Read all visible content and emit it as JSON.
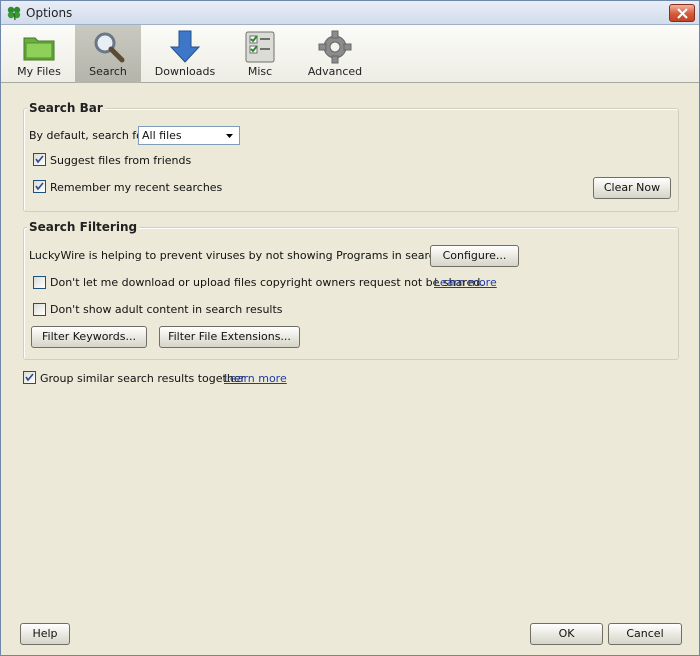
{
  "window": {
    "title": "Options"
  },
  "toolbar": {
    "items": [
      {
        "label": "My Files",
        "icon": "folder-icon"
      },
      {
        "label": "Search",
        "icon": "magnifier-icon",
        "selected": true
      },
      {
        "label": "Downloads",
        "icon": "download-arrow-icon"
      },
      {
        "label": "Misc",
        "icon": "checklist-icon"
      },
      {
        "label": "Advanced",
        "icon": "gear-icon"
      }
    ]
  },
  "search_bar": {
    "title": "Search Bar",
    "default_label": "By default, search for",
    "default_value": "All files",
    "suggest_label": "Suggest files from friends",
    "suggest_checked": true,
    "remember_label": "Remember my recent searches",
    "remember_checked": true,
    "clear_button": "Clear Now"
  },
  "search_filtering": {
    "title": "Search Filtering",
    "virus_text": "LuckyWire is helping to prevent viruses by not showing Programs in search results.",
    "configure_button": "Configure...",
    "copyright_label": "Don't let me download or upload files copyright owners request not be shared.",
    "copyright_checked": false,
    "copyright_link": "Learn more",
    "adult_label": "Don't show adult content in search results",
    "adult_checked": false,
    "keywords_button": "Filter Keywords...",
    "extensions_button": "Filter File Extensions..."
  },
  "group_similar": {
    "label": "Group similar search results together",
    "checked": true,
    "link": "Learn more"
  },
  "footer": {
    "help_button": "Help",
    "ok_button": "OK",
    "cancel_button": "Cancel"
  }
}
